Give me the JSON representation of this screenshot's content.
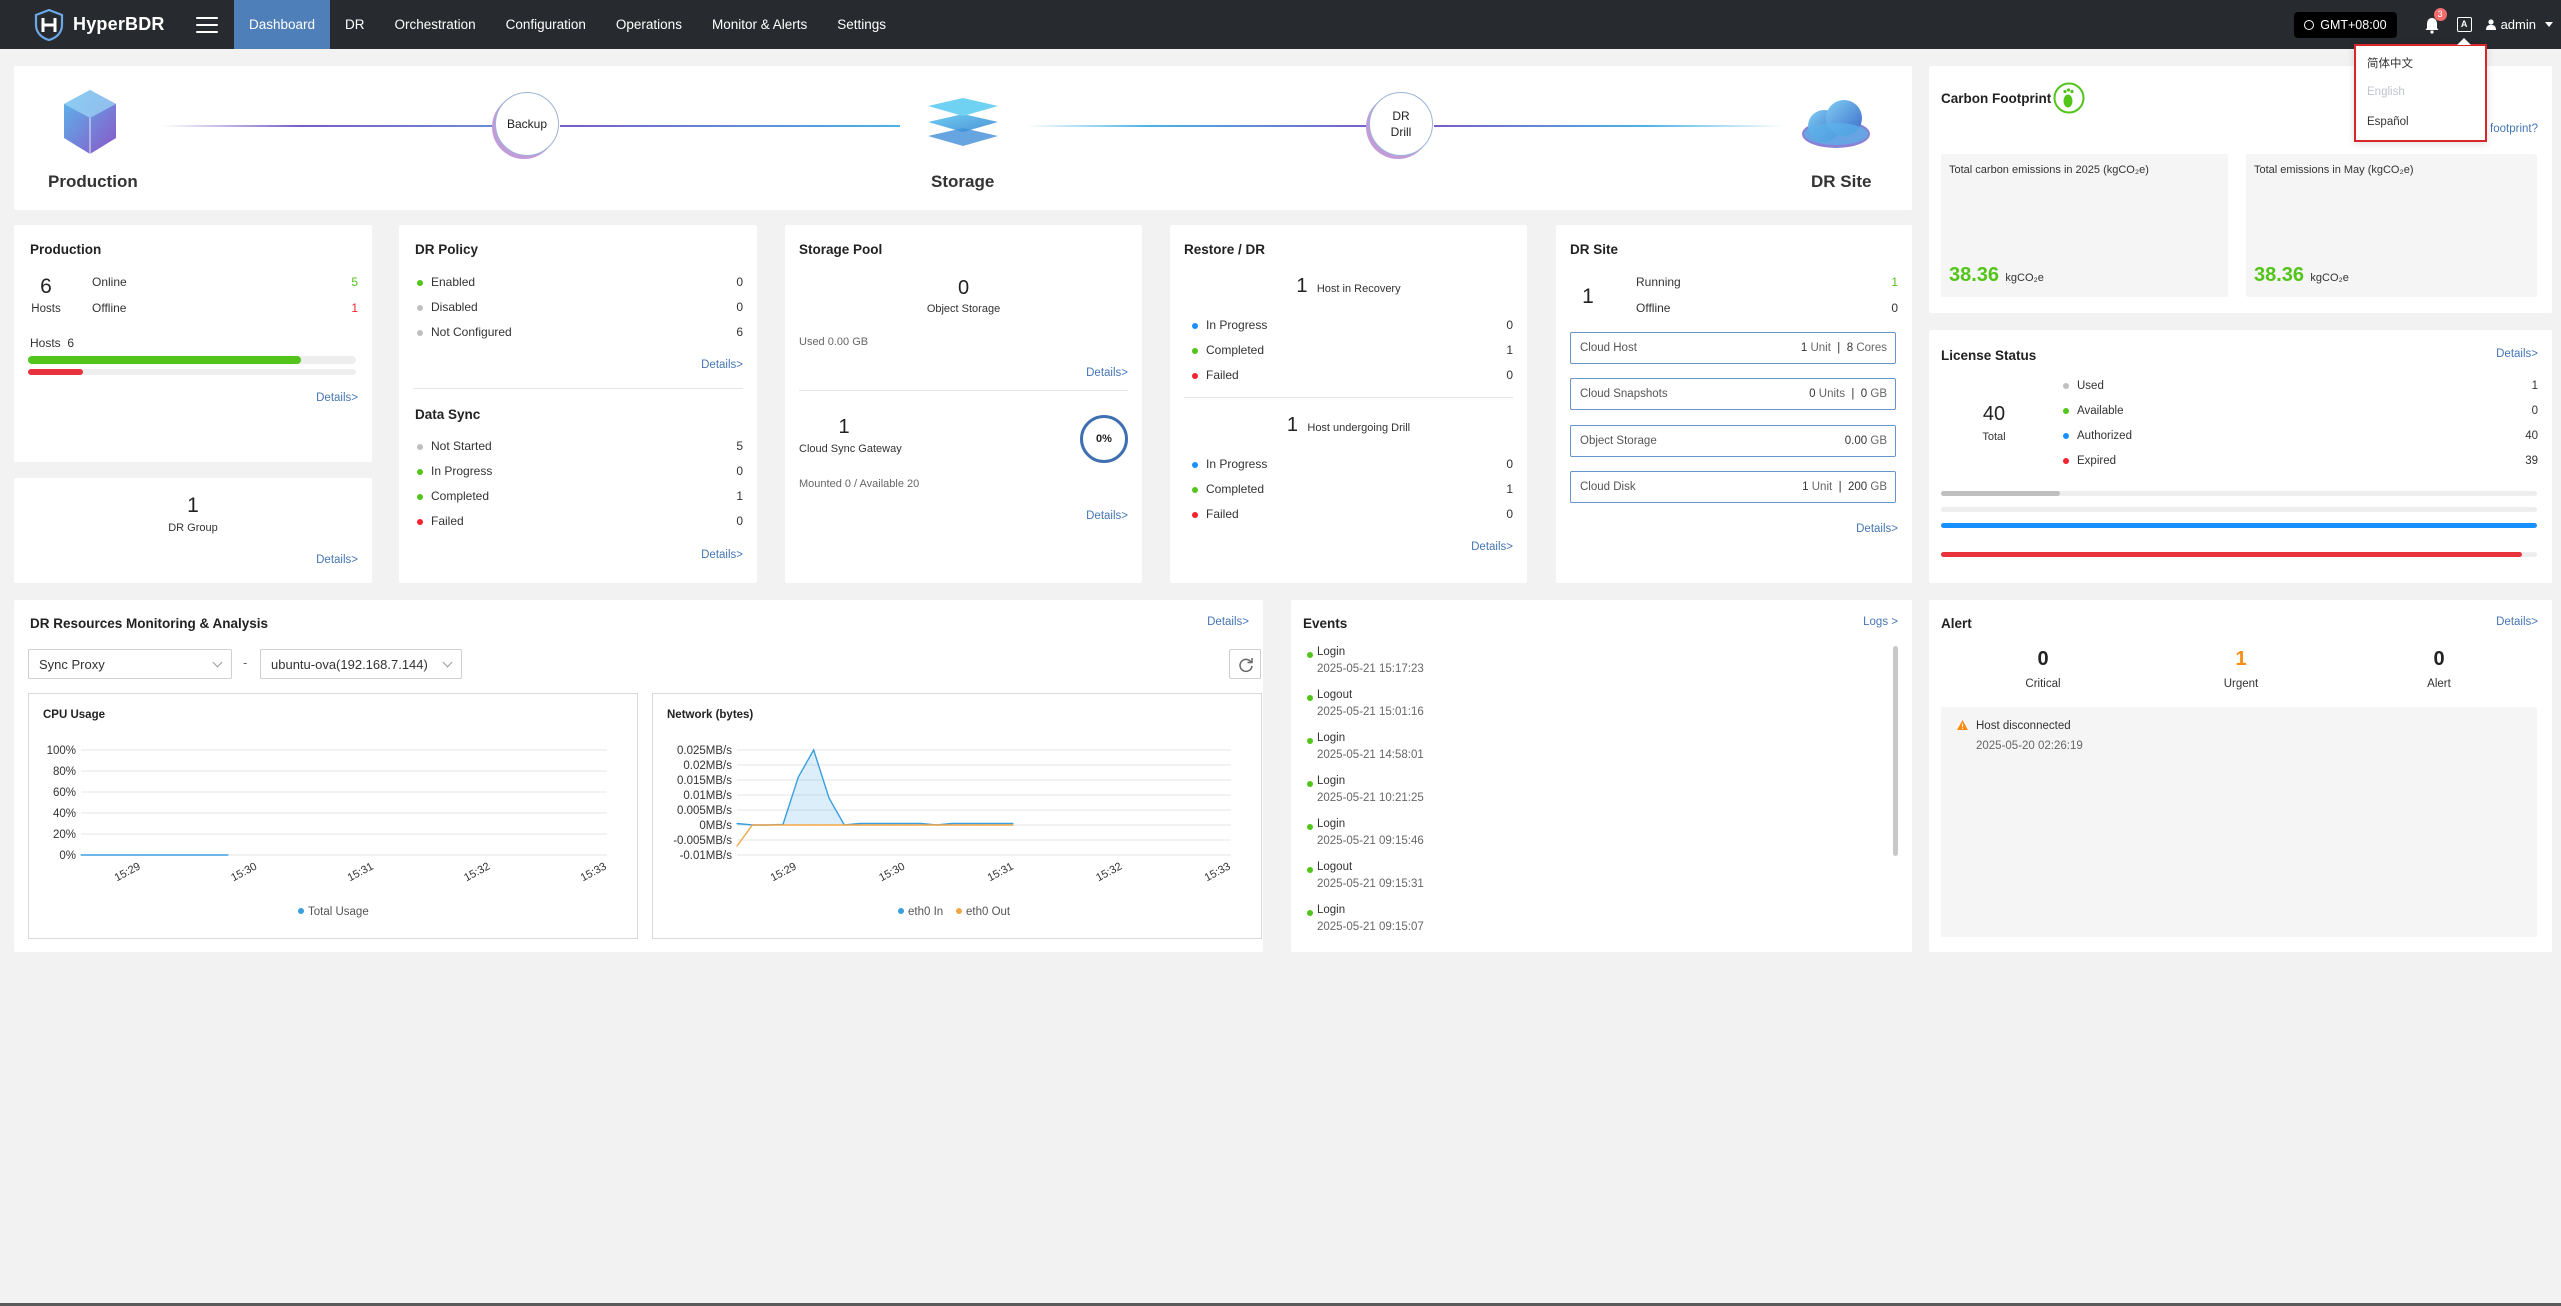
{
  "app": {
    "name": "HyperBDR"
  },
  "nav": {
    "items": [
      {
        "label": "Dashboard",
        "active": true
      },
      {
        "label": "DR",
        "active": false
      },
      {
        "label": "Orchestration",
        "active": false
      },
      {
        "label": "Configuration",
        "active": false
      },
      {
        "label": "Operations",
        "active": false
      },
      {
        "label": "Monitor & Alerts",
        "active": false
      },
      {
        "label": "Settings",
        "active": false
      }
    ],
    "timezone": "GMT+08:00",
    "notification_count": "3",
    "lang_icon": "A",
    "user": "admin",
    "icons": [
      "clock-icon",
      "bell-icon",
      "language-icon",
      "user-icon",
      "chevron-down-icon",
      "menu-icon"
    ]
  },
  "language_menu": {
    "options": [
      {
        "label": "简体中文",
        "disabled": false
      },
      {
        "label": "English",
        "disabled": true
      },
      {
        "label": "Español",
        "disabled": false
      }
    ]
  },
  "topology": {
    "production": "Production",
    "backup": "Backup",
    "storage": "Storage",
    "drill_line1": "DR",
    "drill_line2": "Drill",
    "dr_site": "DR Site"
  },
  "production": {
    "title": "Production",
    "hosts_count": "6",
    "hosts_label": "Hosts",
    "online_label": "Online",
    "online_value": "5",
    "offline_label": "Offline",
    "offline_value": "1",
    "hosts_bar_label": "Hosts",
    "hosts_bar_value": "6",
    "online_fraction": 0.833,
    "offline_fraction": 0.167,
    "details": "Details>"
  },
  "dr_group": {
    "count": "1",
    "label": "DR Group",
    "details": "Details>"
  },
  "dr_policy": {
    "title": "DR Policy",
    "rows": [
      {
        "label": "Enabled",
        "value": "0",
        "color": "#52c41a"
      },
      {
        "label": "Disabled",
        "value": "0",
        "color": "#bfbfbf"
      },
      {
        "label": "Not Configured",
        "value": "6",
        "color": "#bfbfbf"
      }
    ],
    "details": "Details>"
  },
  "data_sync": {
    "title": "Data Sync",
    "rows": [
      {
        "label": "Not Started",
        "value": "5",
        "color": "#bfbfbf"
      },
      {
        "label": "In Progress",
        "value": "0",
        "color": "#52c41a"
      },
      {
        "label": "Completed",
        "value": "1",
        "color": "#52c41a"
      },
      {
        "label": "Failed",
        "value": "0",
        "color": "#f5222d"
      }
    ],
    "details": "Details>"
  },
  "storage_pool": {
    "title": "Storage Pool",
    "object_count": "0",
    "object_label": "Object Storage",
    "used": "Used 0.00 GB",
    "details1": "Details>",
    "gateway_count": "1",
    "gateway_label": "Cloud Sync Gateway",
    "gateway_percent": "0%",
    "mounted": "Mounted 0 / Available 20",
    "details2": "Details>"
  },
  "restore_dr": {
    "title": "Restore / DR",
    "recovery_count": "1",
    "recovery_label": "Host in Recovery",
    "recovery_rows": [
      {
        "label": "In Progress",
        "value": "0",
        "color": "#1890ff"
      },
      {
        "label": "Completed",
        "value": "1",
        "color": "#52c41a"
      },
      {
        "label": "Failed",
        "value": "0",
        "color": "#f5222d"
      }
    ],
    "drill_count": "1",
    "drill_label": "Host undergoing Drill",
    "drill_rows": [
      {
        "label": "In Progress",
        "value": "0",
        "color": "#1890ff"
      },
      {
        "label": "Completed",
        "value": "1",
        "color": "#52c41a"
      },
      {
        "label": "Failed",
        "value": "0",
        "color": "#f5222d"
      }
    ],
    "details": "Details>"
  },
  "dr_site": {
    "title": "DR Site",
    "count": "1",
    "running_label": "Running",
    "running_value": "1",
    "offline_label": "Offline",
    "offline_value": "0",
    "boxes": [
      {
        "label": "Cloud Host",
        "v1": "1",
        "u1": "Unit",
        "v2": "8",
        "u2": "Cores"
      },
      {
        "label": "Cloud Snapshots",
        "v1": "0",
        "u1": "Units",
        "v2": "0",
        "u2": "GB"
      },
      {
        "label": "Object Storage",
        "v1": "",
        "u1": "",
        "v2": "0.00",
        "u2": "GB"
      },
      {
        "label": "Cloud Disk",
        "v1": "1",
        "u1": "Unit",
        "v2": "200",
        "u2": "GB"
      }
    ],
    "details": "Details>"
  },
  "carbon": {
    "title": "Carbon Footprint",
    "link": "r footprint?",
    "boxes": [
      {
        "label": "Total carbon emissions in 2025 (kgCO₂e)",
        "value": "38.36",
        "unit": "kgCO₂e"
      },
      {
        "label": "Total emissions in May (kgCO₂e)",
        "value": "38.36",
        "unit": "kgCO₂e"
      }
    ]
  },
  "license": {
    "title": "License Status",
    "details": "Details>",
    "total": "40",
    "total_label": "Total",
    "rows": [
      {
        "label": "Used",
        "value": "1",
        "color": "#bfbfbf"
      },
      {
        "label": "Available",
        "value": "0",
        "color": "#52c41a"
      },
      {
        "label": "Authorized",
        "value": "40",
        "color": "#1890ff"
      },
      {
        "label": "Expired",
        "value": "39",
        "color": "#f5222d"
      }
    ],
    "used_fraction": 0.025,
    "authorized_fraction": 1.0,
    "expired_fraction": 0.975
  },
  "monitoring": {
    "title": "DR Resources Monitoring & Analysis",
    "details": "Details>",
    "select1": "Sync Proxy",
    "select2": "ubuntu-ova(192.168.7.144)",
    "separator": "-"
  },
  "events": {
    "title": "Events",
    "logs": "Logs >",
    "items": [
      {
        "name": "Login",
        "time": "2025-05-21 15:17:23"
      },
      {
        "name": "Logout",
        "time": "2025-05-21 15:01:16"
      },
      {
        "name": "Login",
        "time": "2025-05-21 14:58:01"
      },
      {
        "name": "Login",
        "time": "2025-05-21 10:21:25"
      },
      {
        "name": "Login",
        "time": "2025-05-21 09:15:46"
      },
      {
        "name": "Logout",
        "time": "2025-05-21 09:15:31"
      },
      {
        "name": "Login",
        "time": "2025-05-21 09:15:07"
      }
    ]
  },
  "alert": {
    "title": "Alert",
    "details": "Details>",
    "counts": [
      {
        "value": "0",
        "label": "Critical",
        "color": "#222"
      },
      {
        "value": "1",
        "label": "Urgent",
        "color": "#fa8c16"
      },
      {
        "value": "0",
        "label": "Alert",
        "color": "#222"
      }
    ],
    "item_title": "Host disconnected",
    "item_time": "2025-05-20 02:26:19"
  },
  "chart_data": [
    {
      "type": "line",
      "title": "CPU Usage",
      "x": [
        "15:29",
        "15:30",
        "15:31",
        "15:32",
        "15:33"
      ],
      "y_ticks": [
        "100%",
        "80%",
        "60%",
        "40%",
        "20%",
        "0%"
      ],
      "ylim": [
        0,
        100
      ],
      "series": [
        {
          "name": "Total Usage",
          "color": "#3a9fe0",
          "values": [
            0,
            0,
            0,
            null,
            null
          ]
        }
      ],
      "legend": "bottom"
    },
    {
      "type": "area",
      "title": "Network (bytes)",
      "x": [
        "15:29",
        "15:30",
        "15:31",
        "15:32",
        "15:33"
      ],
      "y_ticks": [
        "0.025MB/s",
        "0.02MB/s",
        "0.015MB/s",
        "0.01MB/s",
        "0.005MB/s",
        "0MB/s",
        "-0.005MB/s",
        "-0.01MB/s"
      ],
      "ylim": [
        -0.01,
        0.025
      ],
      "series": [
        {
          "name": "eth0 In",
          "color": "#3a9fe0",
          "values": [
            0.0005,
            0,
            0,
            0.0002,
            0.016,
            0.025,
            0.009,
            0,
            0.0005,
            0.0005,
            0.0005,
            0.0005,
            0.0005,
            0,
            0.0005,
            0.0005,
            0.0005,
            0.0005,
            0.0005
          ]
        },
        {
          "name": "eth0 Out",
          "color": "#f2a648",
          "values": [
            -0.007,
            0,
            0,
            0,
            0,
            0,
            0,
            0,
            0,
            0,
            0,
            0,
            0,
            0,
            0,
            0,
            0,
            0,
            0
          ]
        }
      ],
      "legend": "bottom"
    }
  ]
}
